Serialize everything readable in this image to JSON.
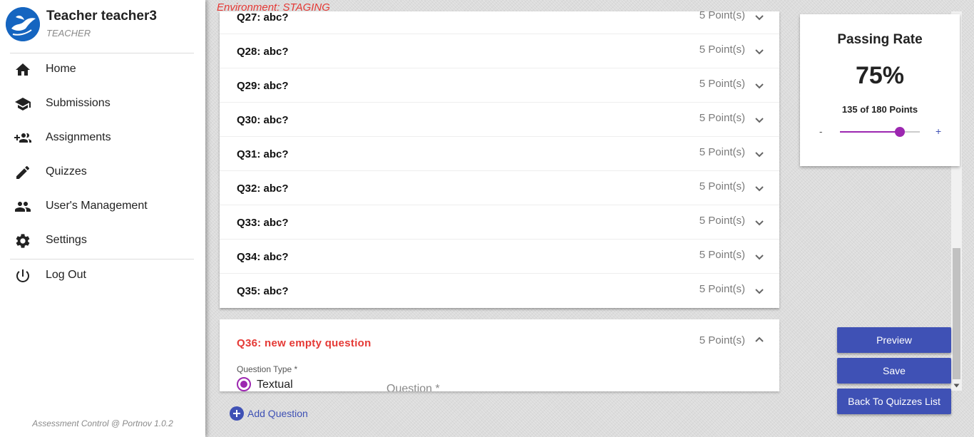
{
  "environment": "Environment: STAGING",
  "user": {
    "name": "Teacher teacher3",
    "role": "TEACHER"
  },
  "nav": [
    {
      "label": "Home",
      "icon": "home-icon"
    },
    {
      "label": "Submissions",
      "icon": "school-icon"
    },
    {
      "label": "Assignments",
      "icon": "add-group-icon"
    },
    {
      "label": "Quizzes",
      "icon": "pencil-icon"
    },
    {
      "label": "User's Management",
      "icon": "people-icon"
    },
    {
      "label": "Settings",
      "icon": "gear-icon"
    }
  ],
  "logout": {
    "label": "Log Out",
    "icon": "power-icon"
  },
  "footer": "Assessment Control @ Portnov 1.0.2",
  "questions": [
    {
      "title": "Q27: abc?",
      "points": "5 Point(s)"
    },
    {
      "title": "Q28: abc?",
      "points": "5 Point(s)"
    },
    {
      "title": "Q29: abc?",
      "points": "5 Point(s)"
    },
    {
      "title": "Q30: abc?",
      "points": "5 Point(s)"
    },
    {
      "title": "Q31: abc?",
      "points": "5 Point(s)"
    },
    {
      "title": "Q32: abc?",
      "points": "5 Point(s)"
    },
    {
      "title": "Q33: abc?",
      "points": "5 Point(s)"
    },
    {
      "title": "Q34: abc?",
      "points": "5 Point(s)"
    },
    {
      "title": "Q35: abc?",
      "points": "5 Point(s)"
    }
  ],
  "expanded_question": {
    "title": "Q36: new empty question",
    "points": "5 Point(s)",
    "type_label": "Question Type *",
    "type_value": "Textual",
    "question_placeholder": "Question *"
  },
  "add_question": "Add Question",
  "passing_rate": {
    "title": "Passing Rate",
    "value": "75%",
    "points_text": "135 of 180 Points",
    "minus": "-",
    "plus": "+",
    "slider_fraction": 0.75
  },
  "actions": {
    "preview": "Preview",
    "save": "Save",
    "back": "Back To Quizzes List"
  },
  "colors": {
    "primary": "#3f51b5",
    "accent": "#9c27b0",
    "error": "#e53935"
  }
}
